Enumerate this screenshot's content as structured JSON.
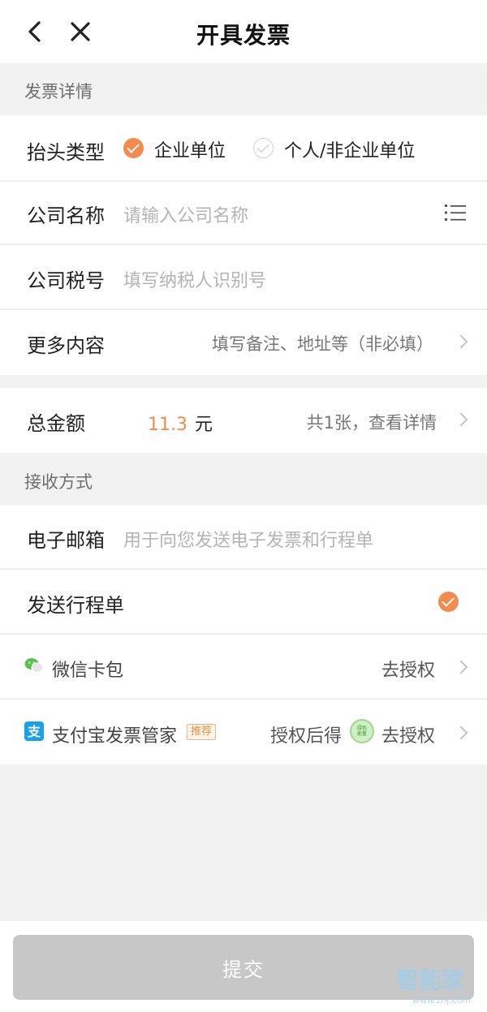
{
  "header": {
    "title": "开具发票"
  },
  "sections": {
    "invoice_details": "发票详情",
    "receive_method": "接收方式"
  },
  "title_type": {
    "label": "抬头类型",
    "options": [
      {
        "label": "企业单位",
        "selected": true
      },
      {
        "label": "个人/非企业单位",
        "selected": false
      }
    ]
  },
  "company_name": {
    "label": "公司名称",
    "placeholder": "请输入公司名称"
  },
  "tax_id": {
    "label": "公司税号",
    "placeholder": "填写纳税人识别号"
  },
  "more": {
    "label": "更多内容",
    "hint": "填写备注、地址等（非必填）"
  },
  "total": {
    "label": "总金额",
    "amount": "11.3",
    "unit": "元",
    "detail": "共1张，查看详情"
  },
  "email": {
    "label": "电子邮箱",
    "placeholder": "用于向您发送电子发票和行程单"
  },
  "itinerary": {
    "label": "发送行程单",
    "checked": true
  },
  "wechat": {
    "label": "微信卡包",
    "action": "去授权"
  },
  "alipay": {
    "label": "支付宝发票管家",
    "badge": "推荐",
    "prefix": "授权后得",
    "coin_text": "绿色能量",
    "action": "去授权"
  },
  "submit": {
    "label": "提交"
  },
  "watermark": {
    "main": "智能家",
    "sub": "www.znj.com"
  },
  "colors": {
    "accent": "#f28b4c",
    "disabled_button": "#c7c7c7",
    "alipay_blue": "#1aa1ea",
    "wechat_green": "#5ac24c"
  }
}
